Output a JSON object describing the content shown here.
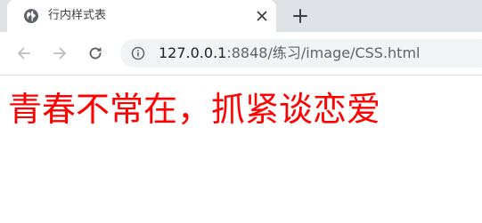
{
  "tab": {
    "title": "行内样式表",
    "favicon": "globe-icon",
    "close_icon": "close-icon"
  },
  "newtab_icon": "plus-icon",
  "toolbar": {
    "back_icon": "arrow-left-icon",
    "forward_icon": "arrow-right-icon",
    "reload_icon": "reload-icon",
    "site_info_icon": "info-icon",
    "url_host": "127.0.0.1",
    "url_path": ":8848/练习/image/CSS.html"
  },
  "page": {
    "heading": "青春不常在，抓紧谈恋爱",
    "heading_color": "#ff0000"
  }
}
